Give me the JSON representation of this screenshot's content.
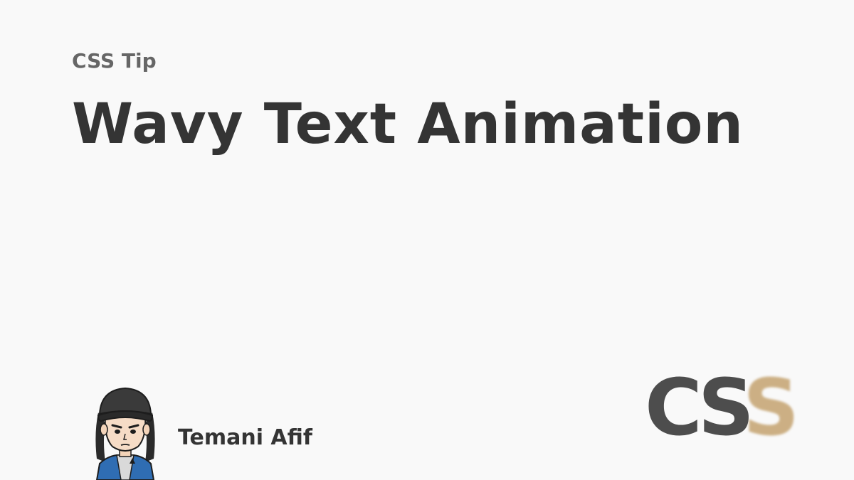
{
  "header": {
    "eyebrow": "CSS Tip",
    "title": "Wavy Text Animation"
  },
  "author": {
    "name": "Temani Afif",
    "avatar_icon": "cartoon-avatar-icon"
  },
  "logo": {
    "text": "CSS",
    "colors": {
      "primary": "#4d4d4d",
      "accent": "#c8a878"
    }
  },
  "colors": {
    "background": "#f9f9f9",
    "eyebrow": "#666666",
    "title": "#343434"
  }
}
